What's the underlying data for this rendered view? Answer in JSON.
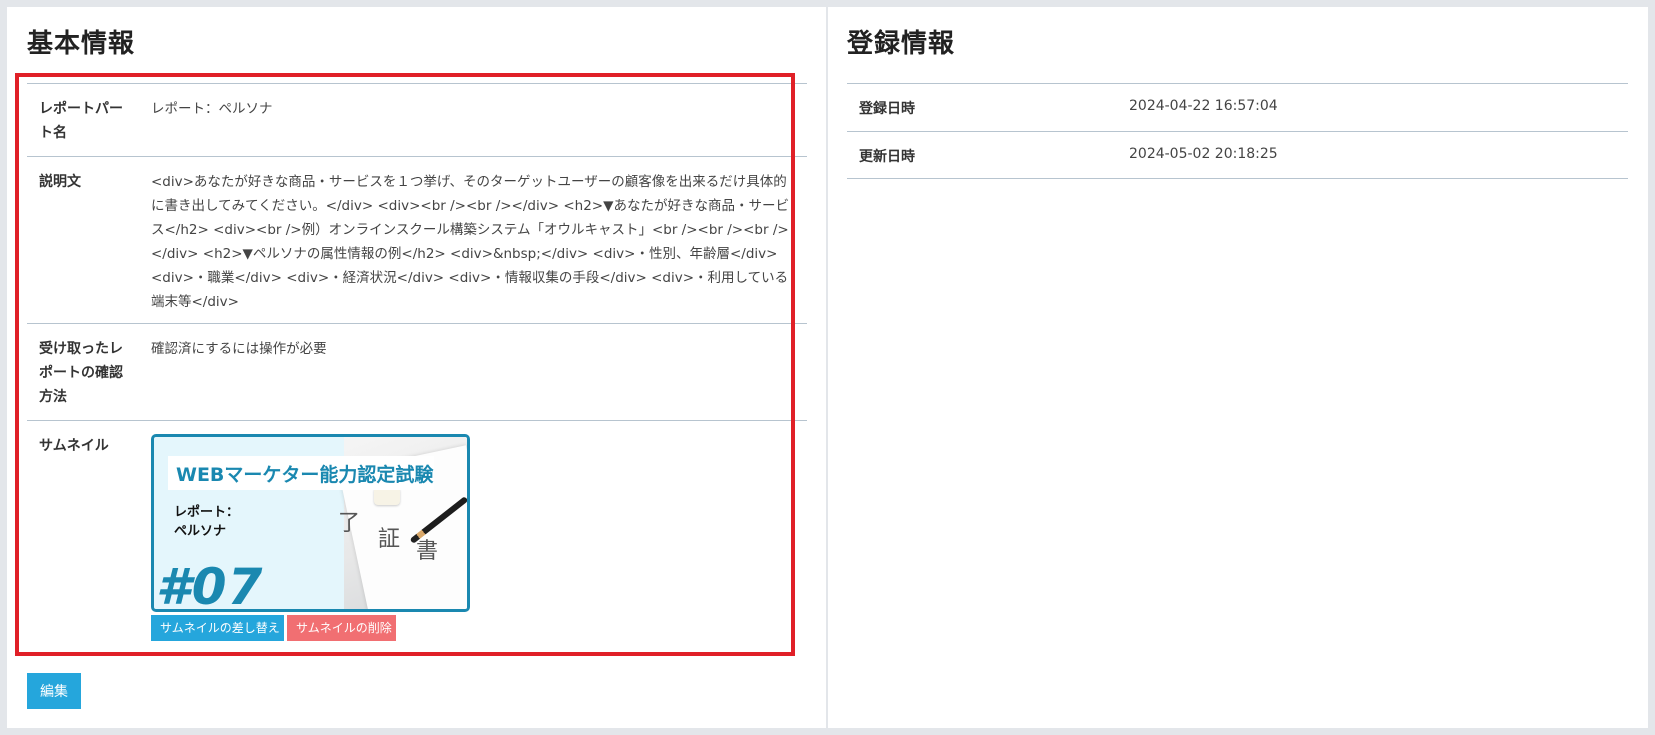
{
  "basic_info": {
    "title": "基本情報",
    "rows": [
      {
        "label": "レポートパート名",
        "value": "レポート：ペルソナ"
      },
      {
        "label": "説明文",
        "value": "<div>あなたが好きな商品・サービスを１つ挙げ、そのターゲットユーザーの顧客像を出来るだけ具体的に書き出してみてください。</div> <div><br /><br /></div> <h2>▼あなたが好きな商品・サービス</h2> <div><br />例）オンラインスクール構築システム「オウルキャスト」<br /><br /><br /></div> <h2>▼ペルソナの属性情報の例</h2> <div>&nbsp;</div> <div>・性別、年齢層</div> <div>・職業</div> <div>・経済状況</div> <div>・情報収集の手段</div> <div>・利用している端末等</div>"
      },
      {
        "label": "受け取ったレポートの確認方法",
        "value": "確認済にするには操作が必要"
      },
      {
        "label": "サムネイル"
      }
    ],
    "thumbnail": {
      "title": "WEBマーケター能力認定試験",
      "subtitle_line1": "レポート：",
      "subtitle_line2": "ペルソナ",
      "number": "#07"
    },
    "replace_button": "サムネイルの差し替え",
    "delete_button": "サムネイルの削除",
    "edit_button": "編集",
    "colors": {
      "highlight": "#e02027",
      "primary": "#25a6dc",
      "danger": "#f16f72",
      "thumb_accent": "#1a88b0"
    }
  },
  "registration_info": {
    "title": "登録情報",
    "rows": [
      {
        "label": "登録日時",
        "value": "2024-04-22 16:57:04"
      },
      {
        "label": "更新日時",
        "value": "2024-05-02 20:18:25"
      }
    ]
  }
}
